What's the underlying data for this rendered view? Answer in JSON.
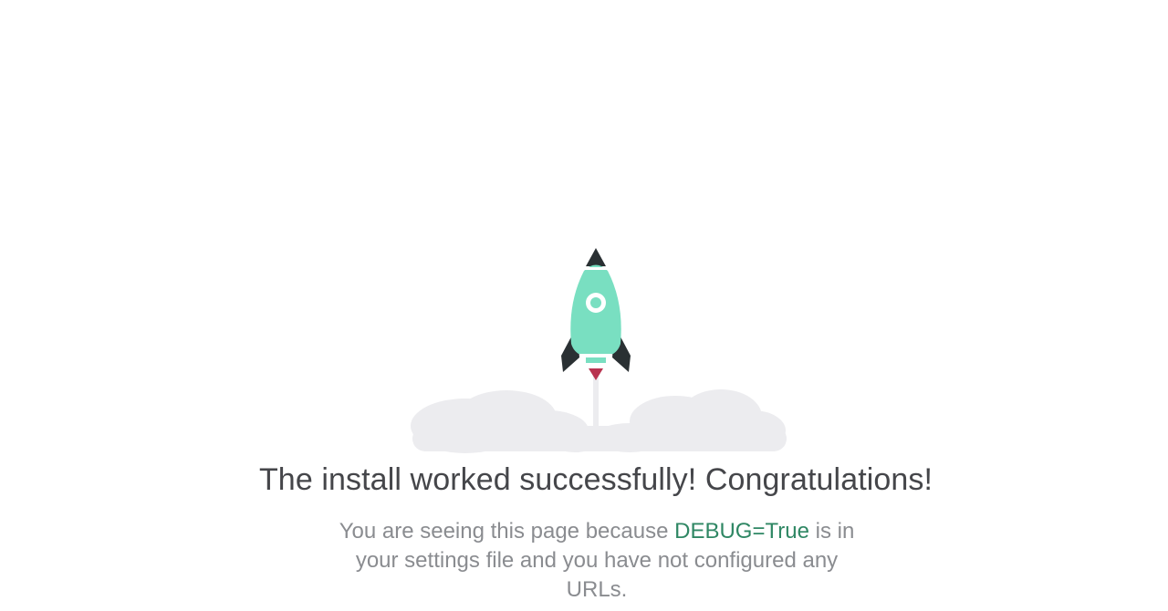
{
  "main": {
    "title": "The install worked successfully! Congratulations!",
    "subtitle": {
      "before": "You are seeing this page because ",
      "highlight": "DEBUG=True",
      "after": " is in your settings file and you have not configured any URLs."
    }
  },
  "illustration": {
    "icon": "rocket-launch-icon"
  },
  "colors": {
    "rocket_body": "#79dfc1",
    "rocket_dark": "#2a3033",
    "flame": "#b8334f",
    "cloud": "#ececef",
    "debug_highlight": "#2f8764",
    "title_text": "#45464a",
    "subtitle_text": "#8a8c90"
  }
}
